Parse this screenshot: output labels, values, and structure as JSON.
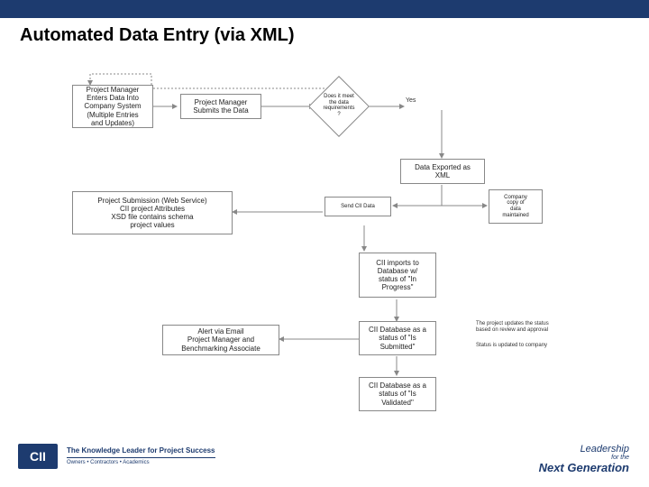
{
  "title": "Automated Data Entry (via XML)",
  "boxes": {
    "pm_enter": "Project Manager\nEnters Data Into\nCompany System\n(Multiple Entries\nand Updates)",
    "pm_submit": "Project Manager\nSubmits the Data",
    "export_xml": "Data Exported as\nXML",
    "submission": "Project Submission (Web Service)\nCII project Attributes\nXSD file contains schema\nproject values",
    "send_cii": "Send CII Data",
    "company_db": "Company\ncopy of\ndata\nmaintained",
    "cii_import": "CII imports to\nDatabase w/\nstatus of \"In\nProgress\"",
    "alert_email": "Alert via Email\nProject Manager and\nBenchmarking Associate",
    "cii_submitted": "CII Database as a\nstatus of \"Is\nSubmitted\"",
    "cii_validated": "CII Database as a\nstatus of \"Is\nValidated\""
  },
  "diamond": {
    "meets": "Does it meet\nthe data\nrequirements\n?"
  },
  "labels": {
    "yes": "Yes"
  },
  "annotations": {
    "anno1": "The project updates the status\nbased on review and approval",
    "anno2": "Status is updated to company"
  },
  "footer": {
    "logo": "CII",
    "tagline": "The Knowledge Leader for Project Success",
    "subline": "Owners • Contractors • Academics",
    "right1": "Leadership",
    "right2": "for the",
    "right3": "Next Generation"
  }
}
